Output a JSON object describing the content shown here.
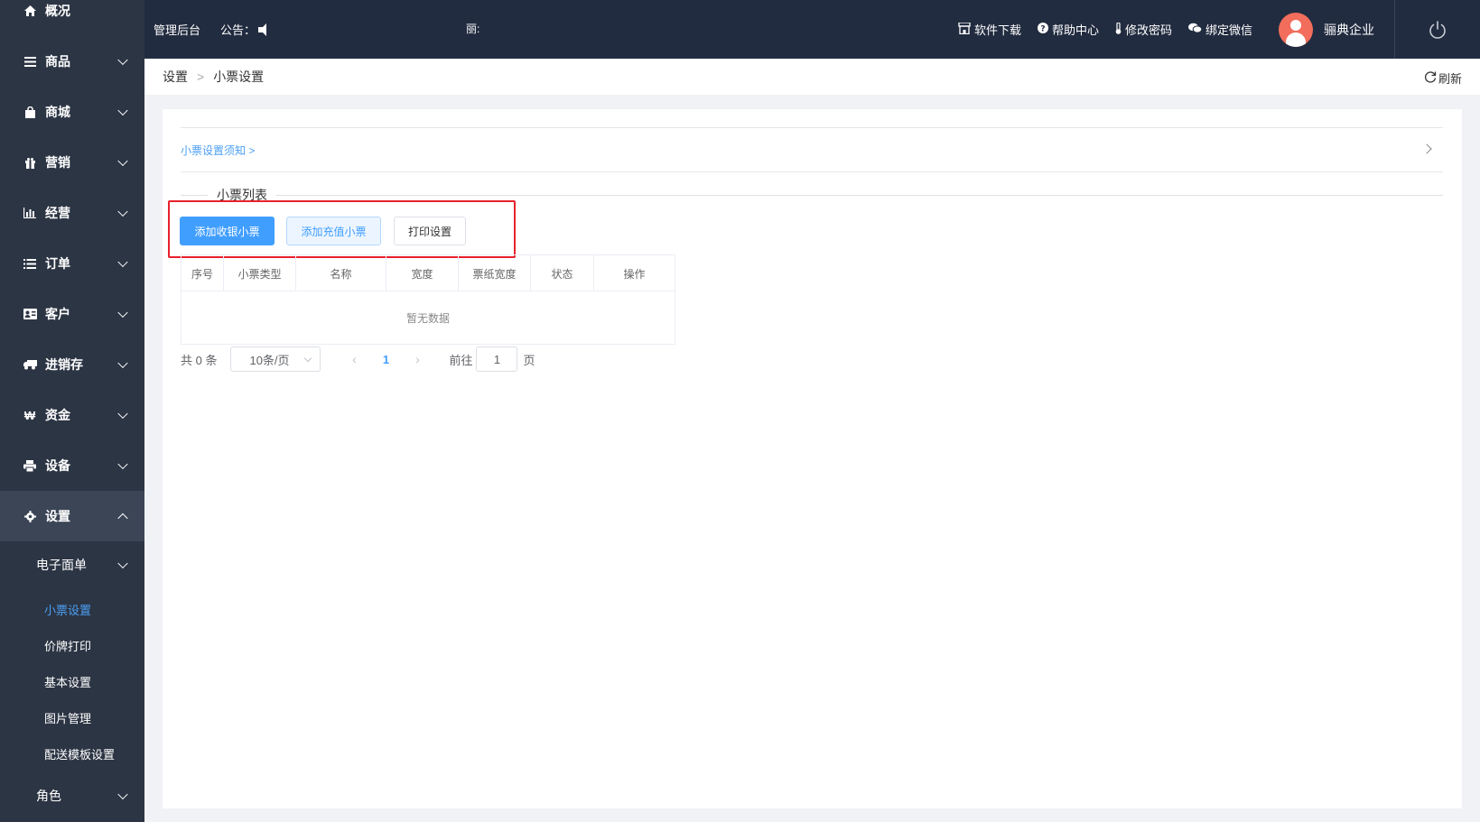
{
  "sidebar": {
    "items": [
      {
        "label": "概况",
        "icon": "home-icon"
      },
      {
        "label": "商品",
        "icon": "list-icon"
      },
      {
        "label": "商城",
        "icon": "bag-icon"
      },
      {
        "label": "营销",
        "icon": "gift-icon"
      },
      {
        "label": "经营",
        "icon": "bar-chart-icon"
      },
      {
        "label": "订单",
        "icon": "order-list-icon"
      },
      {
        "label": "客户",
        "icon": "id-card-icon"
      },
      {
        "label": "进销存",
        "icon": "truck-icon"
      },
      {
        "label": "资金",
        "icon": "won-icon"
      },
      {
        "label": "设备",
        "icon": "printer-icon"
      },
      {
        "label": "设置",
        "icon": "gear-icon"
      }
    ],
    "sub_group": "电子面单",
    "sub_items": [
      "小票设置",
      "价牌打印",
      "基本设置",
      "图片管理",
      "配送模板设置"
    ],
    "role_group": "角色"
  },
  "topbar": {
    "title": "管理后台",
    "notice_label": "公告：",
    "marquee": "丽:",
    "links": [
      "软件下载",
      "帮助中心",
      "修改密码",
      "绑定微信"
    ],
    "user_name": "骊典企业"
  },
  "breadcrumb": {
    "parent": "设置",
    "current": "小票设置",
    "refresh": "刷新"
  },
  "main": {
    "notice_link": "小票设置须知 >",
    "list_title": "小票列表",
    "buttons": {
      "add_cashier": "添加收银小票",
      "add_recharge": "添加充值小票",
      "print_settings": "打印设置"
    },
    "table": {
      "columns": [
        "序号",
        "小票类型",
        "名称",
        "宽度",
        "票纸宽度",
        "状态",
        "操作"
      ],
      "empty_text": "暂无数据"
    },
    "pager": {
      "total": "共 0 条",
      "page_size": "10条/页",
      "current_page": "1",
      "goto_label": "前往",
      "goto_value": "1",
      "page_unit": "页"
    }
  },
  "colors": {
    "sidebar_bg": "#2c3544",
    "topbar_bg": "#222c40",
    "primary": "#409eff",
    "highlight_border": "#e8212d",
    "avatar": "#f26d5b"
  }
}
